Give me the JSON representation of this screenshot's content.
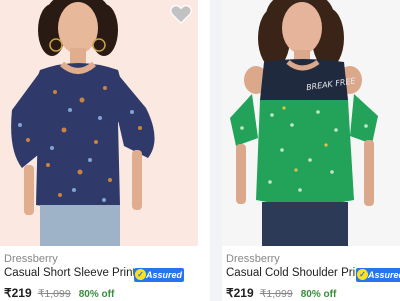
{
  "products": [
    {
      "brand": "Dressberry",
      "title": "Casual Short Sleeve Printed...",
      "assured": "Assured",
      "price": "₹219",
      "mrp": "₹1,099",
      "discount": "80% off",
      "wishlist_icon": "heart-icon"
    },
    {
      "brand": "Dressberry",
      "title": "Casual Cold Shoulder Print...",
      "assured": "Assured",
      "price": "₹219",
      "mrp": "₹1,099",
      "discount": "80% off",
      "graphic_text": "BREAK FREE"
    }
  ],
  "colors": {
    "assured_blue": "#2874f0",
    "discount_green": "#388e3c",
    "top1_navy": "#2f3a6b",
    "top2_green": "#23a35a"
  }
}
